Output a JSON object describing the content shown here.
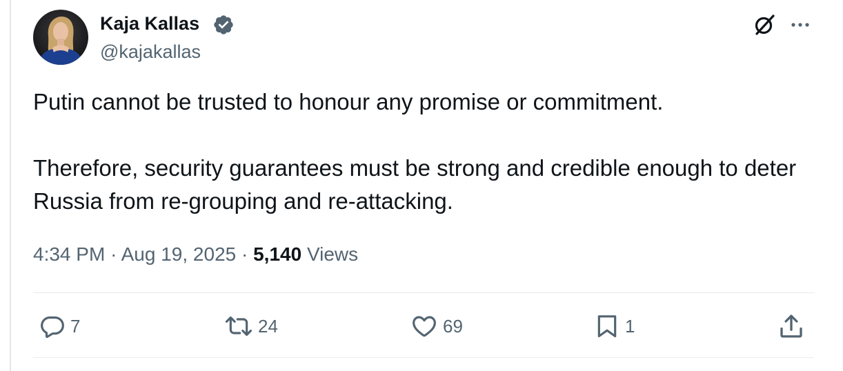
{
  "author": {
    "display_name": "Kaja Kallas",
    "handle": "@kajakallas",
    "verified": true
  },
  "tweet": {
    "paragraphs": [
      "Putin cannot be trusted to honour any promise or commitment.",
      "Therefore, security guarantees must be strong and credible enough to deter Russia from re-grouping and re-attacking."
    ],
    "time": "4:34 PM",
    "separator": "·",
    "date": "Aug 19, 2025",
    "views_count": "5,140",
    "views_label": "Views"
  },
  "actions": {
    "reply_count": "7",
    "retweet_count": "24",
    "like_count": "69",
    "bookmark_count": "1"
  },
  "icons": {
    "verified": "verified-badge-icon",
    "grok": "grok-icon",
    "more": "more-options-icon",
    "reply": "reply-icon",
    "retweet": "retweet-icon",
    "like": "heart-icon",
    "bookmark": "bookmark-icon",
    "share": "share-icon"
  },
  "colors": {
    "text_primary": "#0f1419",
    "text_secondary": "#536471",
    "divider": "#e6e9ec"
  }
}
